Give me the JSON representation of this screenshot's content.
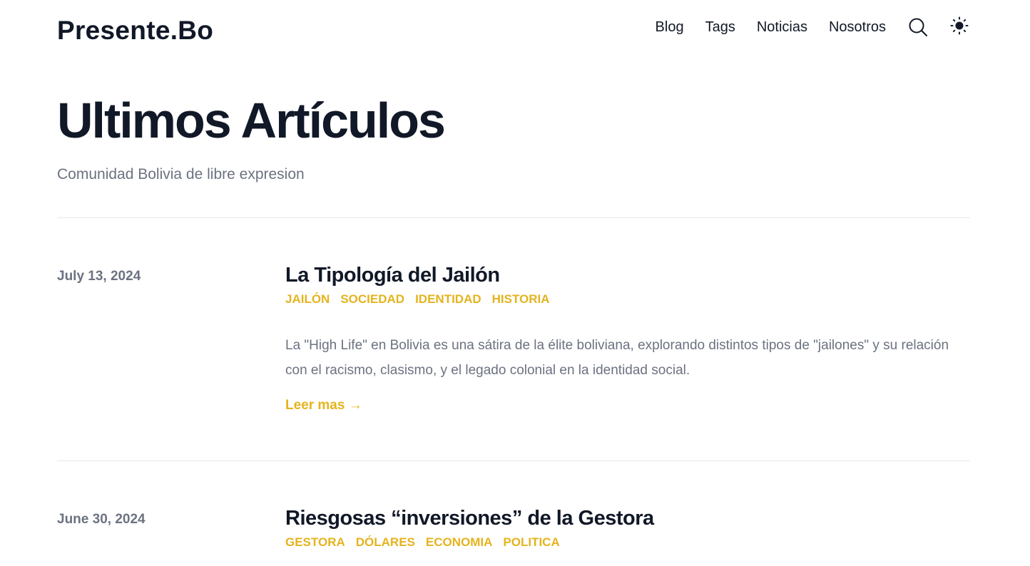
{
  "site": {
    "logo": "Presente.Bo"
  },
  "nav": {
    "items": [
      {
        "label": "Blog"
      },
      {
        "label": "Tags"
      },
      {
        "label": "Noticias"
      },
      {
        "label": "Nosotros"
      }
    ],
    "search_icon": "search-icon",
    "theme_icon": "sun-icon"
  },
  "hero": {
    "title": "Ultimos Artículos",
    "subtitle": "Comunidad Bolivia de libre expresion"
  },
  "posts": [
    {
      "date": "July 13, 2024",
      "title": "La Tipología del Jailón",
      "tags": [
        "JAILÓN",
        "SOCIEDAD",
        "IDENTIDAD",
        "HISTORIA"
      ],
      "summary": "La \"High Life\" en Bolivia es una sátira de la élite boliviana, explorando distintos tipos de \"jailones\" y su relación con el racismo, clasismo, y el legado colonial en la identidad social.",
      "read_more": "Leer mas →"
    },
    {
      "date": "June 30, 2024",
      "title": "Riesgosas “inversiones” de la Gestora",
      "tags": [
        "GESTORA",
        "DÓLARES",
        "ECONOMIA",
        "POLITICA"
      ]
    }
  ],
  "colors": {
    "accent": "#e5b31e",
    "heading": "#111827",
    "muted": "#6b7280",
    "divider": "#e5e7eb"
  }
}
